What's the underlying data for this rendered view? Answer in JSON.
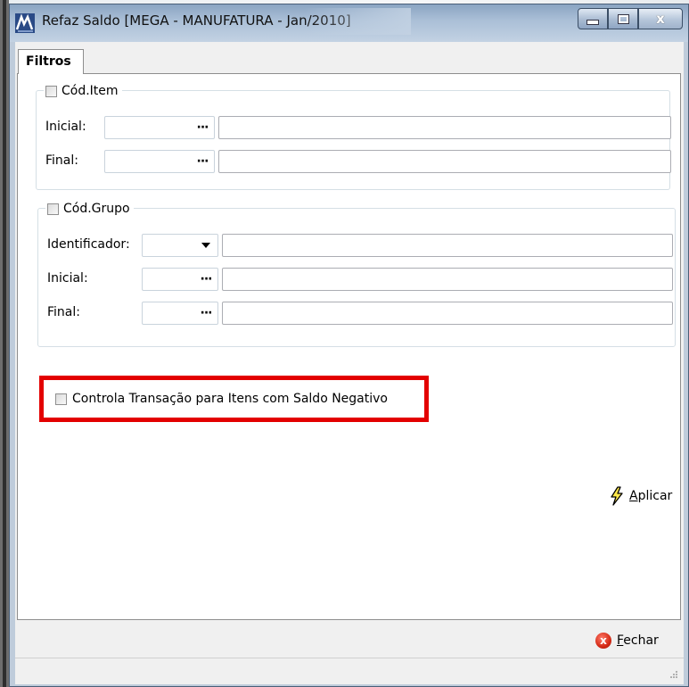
{
  "window": {
    "title": "Refaz Saldo [MEGA - MANUFATURA - Jan/2010]",
    "icon": "mega-app-icon",
    "controls": {
      "minimize_icon": "minimize-icon",
      "maximize_icon": "maximize-icon",
      "close_glyph": "x"
    }
  },
  "tabs": [
    {
      "label": "Filtros",
      "active": true
    }
  ],
  "cod_item_group": {
    "legend": "Cód.Item",
    "checked": false,
    "rows": [
      {
        "label": "Inicial:",
        "code_value": "",
        "lookup_glyph": "···",
        "description": ""
      },
      {
        "label": "Final:",
        "code_value": "",
        "lookup_glyph": "···",
        "description": ""
      }
    ]
  },
  "cod_grupo_group": {
    "legend": "Cód.Grupo",
    "checked": false,
    "rows": [
      {
        "label": "Identificador:",
        "selected": "",
        "description": ""
      },
      {
        "label": "Inicial:",
        "code_value": "",
        "lookup_glyph": "···",
        "description": ""
      },
      {
        "label": "Final:",
        "code_value": "",
        "lookup_glyph": "···",
        "description": ""
      }
    ]
  },
  "controla_transacao": {
    "label": "Controla Transação para Itens com Saldo Negativo",
    "checked": false,
    "highlight_color": "#e30000"
  },
  "aplicar_button": {
    "access_key": "A",
    "label_rest": "plicar",
    "icon": "lightning-icon"
  },
  "fechar_button": {
    "access_key": "F",
    "label_rest": "echar",
    "icon": "close-circle-icon",
    "glyph": "x"
  },
  "colors": {
    "title_bar": "#a9bed6",
    "client_bg": "#f0f0f0",
    "panel_bg": "#ffffff"
  }
}
